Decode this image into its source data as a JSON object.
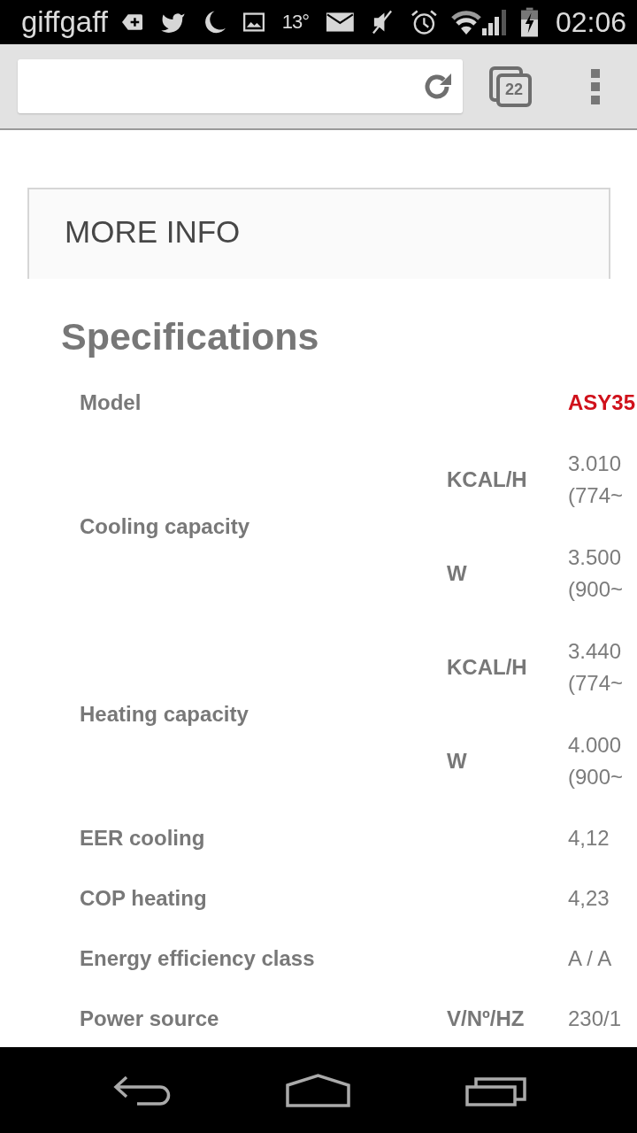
{
  "status_bar": {
    "carrier": "giffgaff",
    "temperature": "13°",
    "time": "02:06"
  },
  "browser_toolbar": {
    "tab_count": "22"
  },
  "more_info": {
    "title": "MORE INFO"
  },
  "specifications": {
    "title": "Specifications",
    "rows": [
      {
        "kind": "single",
        "label": "Model",
        "value": "ASY35",
        "emphasized": true
      },
      {
        "kind": "split",
        "label": "Cooling capacity",
        "parts": [
          {
            "unit": "KCAL/H",
            "value": "3.010 (774~",
            "emphasized": false
          },
          {
            "unit": "W",
            "value": "3.500 (900~",
            "emphasized": false
          }
        ]
      },
      {
        "kind": "split",
        "label": "Heating capacity",
        "parts": [
          {
            "unit": "KCAL/H",
            "value": "3.440 (774~",
            "emphasized": false
          },
          {
            "unit": "W",
            "value": "4.000 (900~",
            "emphasized": false
          }
        ]
      },
      {
        "kind": "single",
        "label": "EER cooling",
        "value": "4,12",
        "emphasized": false
      },
      {
        "kind": "single",
        "label": "COP heating",
        "value": "4,23",
        "emphasized": false
      },
      {
        "kind": "single",
        "label": "Energy efficiency class",
        "value": "A / A",
        "emphasized": false
      },
      {
        "kind": "single",
        "label": "Power source",
        "unit": "V/Nº/HZ",
        "value": "230/1",
        "emphasized": false
      }
    ]
  }
}
